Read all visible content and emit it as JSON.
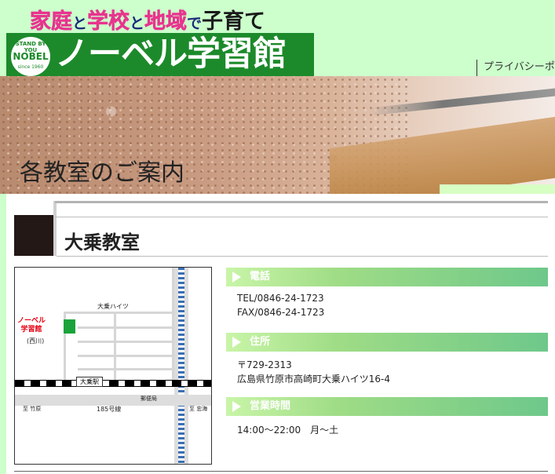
{
  "header": {
    "tagline": [
      "家庭",
      "と",
      "学校",
      "と",
      "地域",
      "で",
      "子育て"
    ],
    "badge_top": "STAND BY YOU",
    "badge_name": "NOBEL",
    "badge_since": "since 1960",
    "logo_text": "ノーベル学習館",
    "privacy_link": "プライバシーポ",
    "colors": {
      "header_bg": "#ccffcc",
      "logo_green": "#1c8a2a",
      "tagline_pink": "#e8348f"
    }
  },
  "banner": {
    "title": "各教室のご案内"
  },
  "classroom": {
    "name": "大乗教室",
    "map": {
      "school_label_1": "ノーベル",
      "school_label_2": "学習館",
      "school_sub": "(西川)",
      "apartment": "大乗ハイツ",
      "station": "大乗駅",
      "post_office": "郵便局",
      "route": "185号線",
      "to_left": "至 竹原",
      "to_right": "至 忠海"
    },
    "phone": {
      "label": "電話",
      "tel": "TEL/0846-24-1723",
      "fax": "FAX/0846-24-1723"
    },
    "address": {
      "label": "住所",
      "zip": "〒729-2313",
      "street": "広島県竹原市高崎町大乗ハイツ16-4"
    },
    "hours": {
      "label": "営業時間",
      "value": "14:00～22:00　月～土"
    }
  }
}
